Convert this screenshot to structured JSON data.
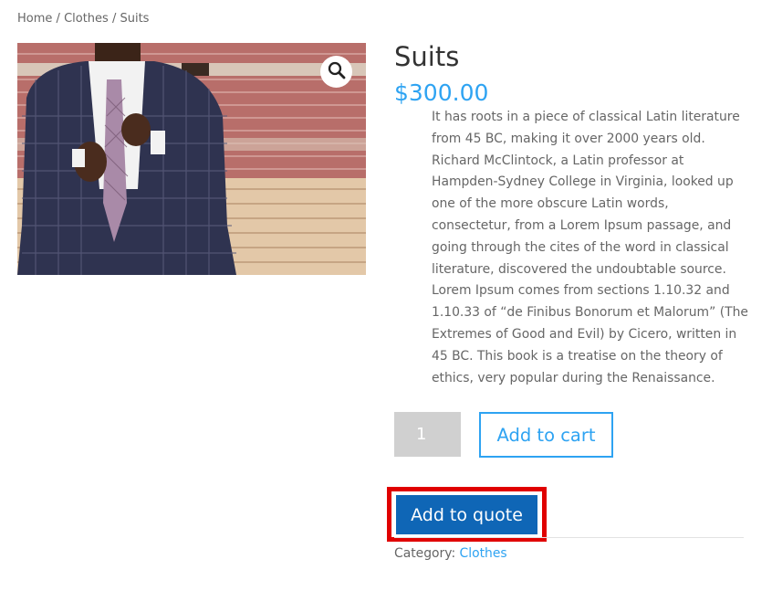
{
  "breadcrumb": {
    "items": [
      "Home",
      "Clothes",
      "Suits"
    ],
    "separator": "/"
  },
  "product": {
    "title": "Suits",
    "price": "$300.00",
    "description": "It has roots in a piece of classical Latin literature from 45 BC, making it over 2000 years old. Richard McClintock, a Latin professor at Hampden-Sydney College in Virginia, looked up one of the more obscure Latin words, consectetur, from a Lorem Ipsum passage, and going through the cites of the word in classical literature, discovered the undoubtable source. Lorem Ipsum comes from sections 1.10.32 and 1.10.33 of “de Finibus Bonorum et Malorum” (The Extremes of Good and Evil) by Cicero, written in 45 BC. This book is a treatise on the theory of ethics, very popular during the Renaissance.",
    "image_icon": "magnifier-icon"
  },
  "cart": {
    "quantity": "1",
    "add_to_cart_label": "Add to cart",
    "add_to_quote_label": "Add to quote"
  },
  "meta": {
    "category_label": "Category:",
    "category_value": "Clothes"
  },
  "colors": {
    "accent": "#2ea3f2",
    "quote_button": "#0f66b6",
    "highlight": "#e00000"
  }
}
